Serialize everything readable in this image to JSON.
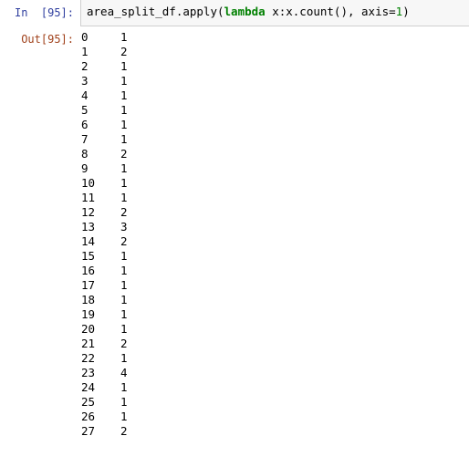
{
  "cell": {
    "in_prompt": "In  [95]:",
    "out_prompt": "Out[95]:",
    "code": {
      "before_kw": "area_split_df.apply(",
      "keyword": "lambda",
      "after_kw": " x:x.count(), axis=",
      "number": "1",
      "tail": ")"
    },
    "code_full": "area_split_df.apply(lambda x:x.count(), axis=1)"
  },
  "colors": {
    "in_prompt": "#303f9f",
    "out_prompt": "#a0411b",
    "keyword": "#008000",
    "number": "#008000",
    "input_bg": "#f7f7f7",
    "input_border": "#cfcfcf",
    "text": "#000000"
  },
  "output": {
    "type": "pandas-series",
    "rows": [
      {
        "index": "0",
        "value": "1"
      },
      {
        "index": "1",
        "value": "2"
      },
      {
        "index": "2",
        "value": "1"
      },
      {
        "index": "3",
        "value": "1"
      },
      {
        "index": "4",
        "value": "1"
      },
      {
        "index": "5",
        "value": "1"
      },
      {
        "index": "6",
        "value": "1"
      },
      {
        "index": "7",
        "value": "1"
      },
      {
        "index": "8",
        "value": "2"
      },
      {
        "index": "9",
        "value": "1"
      },
      {
        "index": "10",
        "value": "1"
      },
      {
        "index": "11",
        "value": "1"
      },
      {
        "index": "12",
        "value": "2"
      },
      {
        "index": "13",
        "value": "3"
      },
      {
        "index": "14",
        "value": "2"
      },
      {
        "index": "15",
        "value": "1"
      },
      {
        "index": "16",
        "value": "1"
      },
      {
        "index": "17",
        "value": "1"
      },
      {
        "index": "18",
        "value": "1"
      },
      {
        "index": "19",
        "value": "1"
      },
      {
        "index": "20",
        "value": "1"
      },
      {
        "index": "21",
        "value": "2"
      },
      {
        "index": "22",
        "value": "1"
      },
      {
        "index": "23",
        "value": "4"
      },
      {
        "index": "24",
        "value": "1"
      },
      {
        "index": "25",
        "value": "1"
      },
      {
        "index": "26",
        "value": "1"
      },
      {
        "index": "27",
        "value": "2"
      }
    ]
  }
}
